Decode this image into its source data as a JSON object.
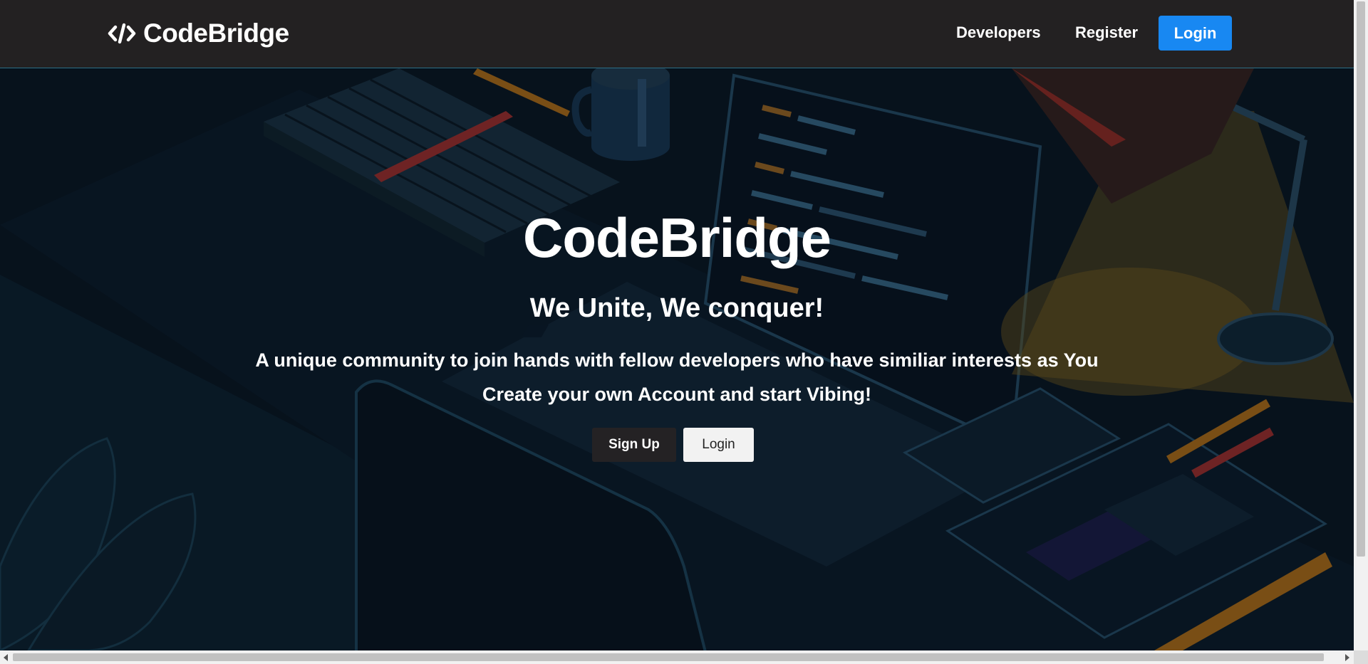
{
  "navbar": {
    "brand": "CodeBridge",
    "brand_icon": "code-icon",
    "links": {
      "developers": "Developers",
      "register": "Register",
      "login": "Login"
    },
    "accent": "#1888f2"
  },
  "hero": {
    "title": "CodeBridge",
    "tagline": "We Unite, We conquer!",
    "description": "A unique community to join hands with fellow developers who have similiar interests as You",
    "cta_text": "Create your own Account and start Vibing!",
    "buttons": {
      "signup": "Sign Up",
      "login": "Login"
    }
  }
}
